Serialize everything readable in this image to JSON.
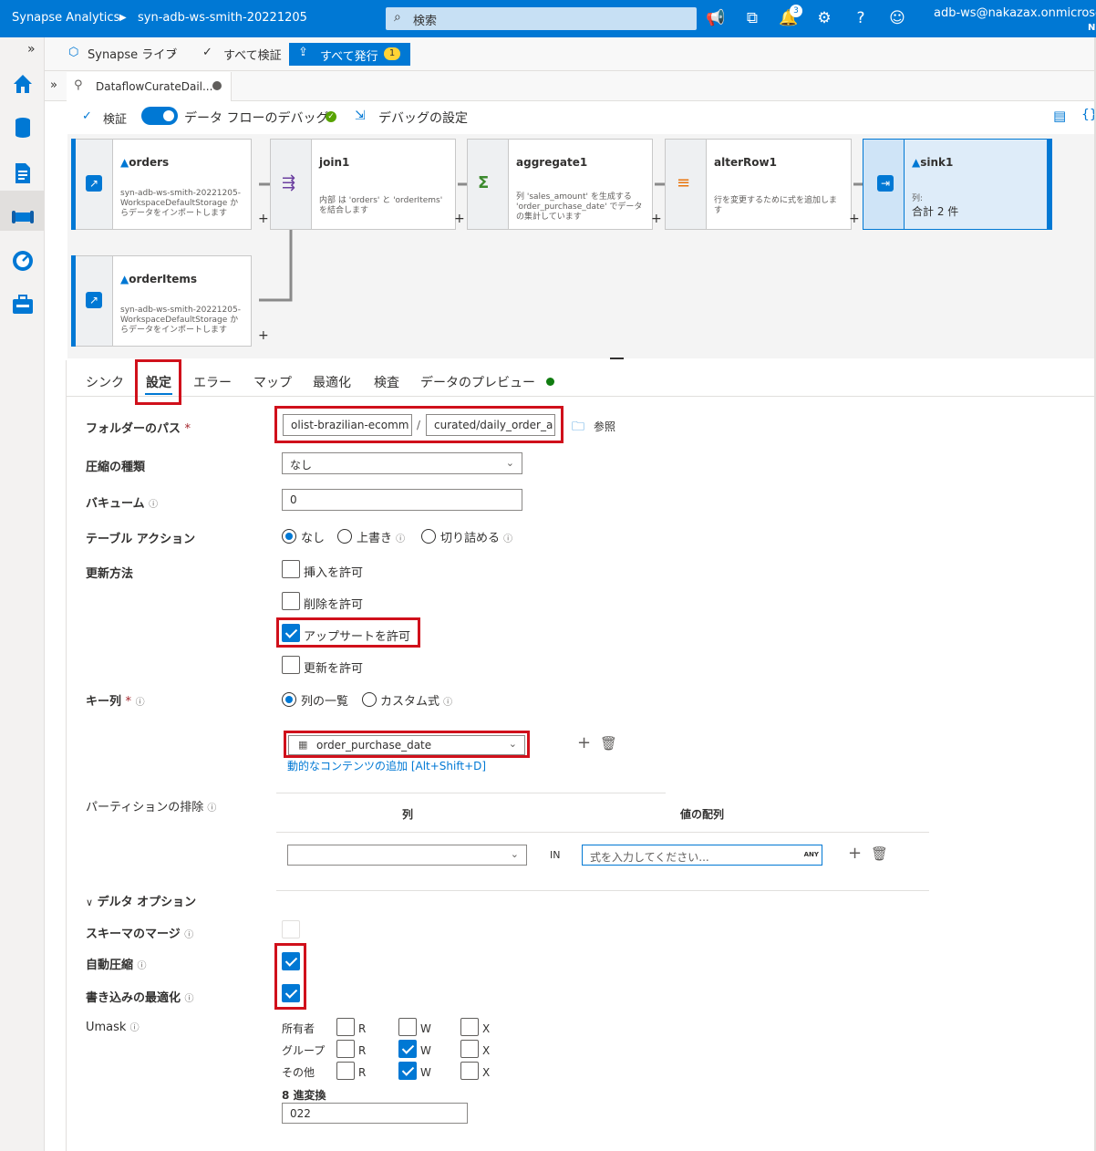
{
  "topbar": {
    "product": "Synapse Analytics",
    "workspace": "syn-adb-ws-smith-20221205",
    "search_placeholder": "検索",
    "notifications_count": "3",
    "user": "adb-ws@nakazax.onmicroso",
    "user_sub": "N"
  },
  "toolbar": {
    "live_mode": "Synapse ライブ",
    "validate_all": "すべて検証",
    "publish_all": "すべて発行",
    "publish_count": "1"
  },
  "tab": {
    "name": "DataflowCurateDail..."
  },
  "debugbar": {
    "validate": "検証",
    "debug_label": "データ フローのデバッグ",
    "debug_settings": "デバッグの設定"
  },
  "nodes": {
    "orders": {
      "title": "orders",
      "desc": "syn-adb-ws-smith-20221205-WorkspaceDefaultStorage からデータをインポートします"
    },
    "join1": {
      "title": "join1",
      "desc": "内部 は 'orders' と 'orderItems' を結合します"
    },
    "aggregate1": {
      "title": "aggregate1",
      "desc": "列 'sales_amount' を生成する 'order_purchase_date' でデータの集計しています"
    },
    "alterRow1": {
      "title": "alterRow1",
      "desc": "行を変更するために式を追加します"
    },
    "sink1": {
      "title": "sink1",
      "desc_label": "列:",
      "desc": "合計 2 件"
    },
    "orderItems": {
      "title": "orderItems",
      "desc": "syn-adb-ws-smith-20221205-WorkspaceDefaultStorage からデータをインポートします"
    }
  },
  "settings_tabs": [
    "シンク",
    "設定",
    "エラー",
    "マップ",
    "最適化",
    "検査",
    "データのプレビュー"
  ],
  "form": {
    "folder_path_label": "フォルダーのパス",
    "folder_container": "olist-brazilian-ecomm",
    "folder_path": "curated/daily_order_a",
    "browse": "参照",
    "compression_label": "圧縮の種類",
    "compression_value": "なし",
    "vacuum_label": "バキューム",
    "vacuum_value": "0",
    "table_action_label": "テーブル アクション",
    "table_action_none": "なし",
    "table_action_overwrite": "上書き",
    "table_action_truncate": "切り詰める",
    "update_method_label": "更新方法",
    "allow_insert": "挿入を許可",
    "allow_delete": "削除を許可",
    "allow_upsert": "アップサートを許可",
    "allow_update": "更新を許可",
    "key_columns_label": "キー列",
    "key_list": "列の一覧",
    "key_custom": "カスタム式",
    "key_column_value": "order_purchase_date",
    "dynamic_content": "動的なコンテンツの追加 [Alt+Shift+D]",
    "partition_label": "パーティションの排除",
    "partition_col_header": "列",
    "partition_values_header": "値の配列",
    "partition_in": "IN",
    "partition_expr_placeholder": "式を入力してください...",
    "partition_any": "ANY",
    "delta_options": "デルタ オプション",
    "schema_merge_label": "スキーマのマージ",
    "auto_compact_label": "自動圧縮",
    "optimize_write_label": "書き込みの最適化",
    "umask_label": "Umask",
    "umask_owner": "所有者",
    "umask_group": "グループ",
    "umask_other": "その他",
    "r": "R",
    "w": "W",
    "x": "X",
    "octal_label": "8 進変換",
    "octal_value": "022"
  }
}
